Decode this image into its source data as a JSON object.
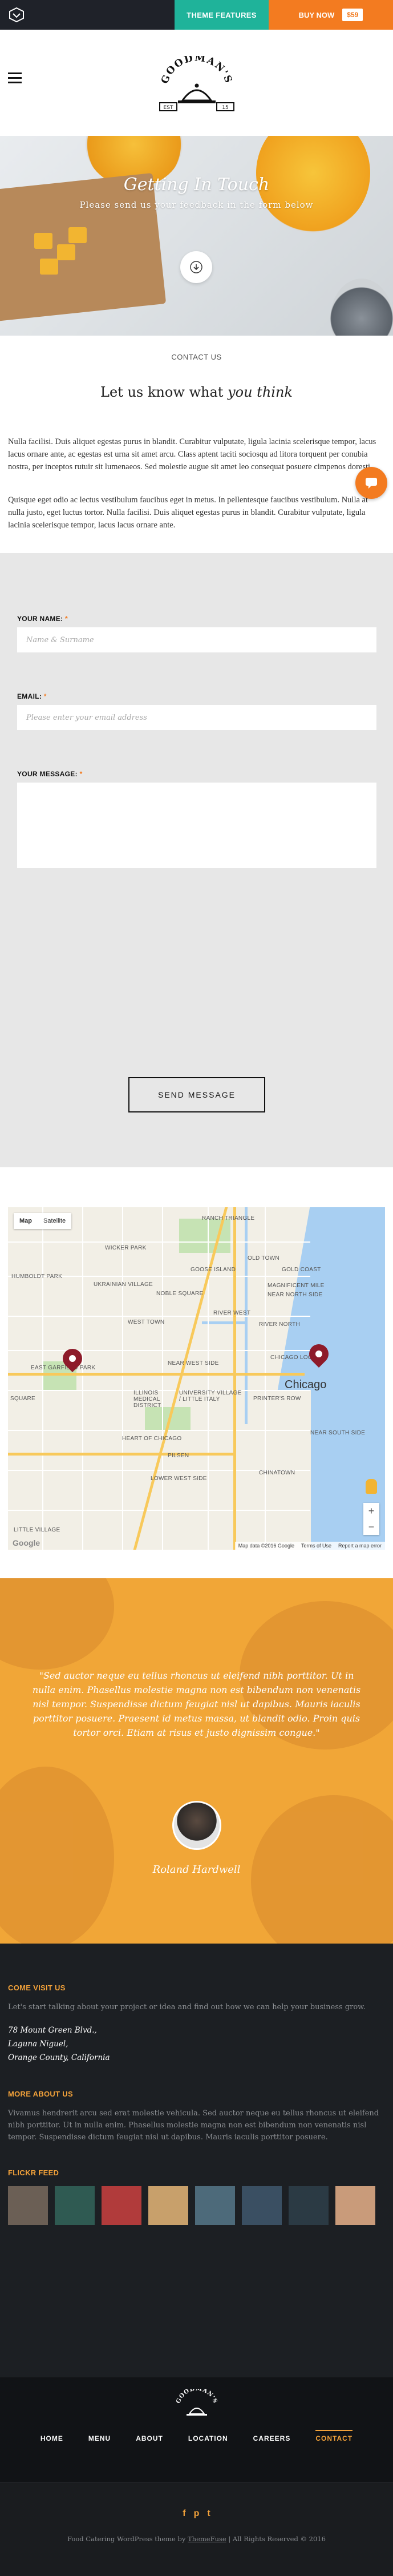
{
  "topbar": {
    "theme_features": "THEME FEATURES",
    "buy_now": "BUY NOW",
    "price": "$59"
  },
  "brand": {
    "name": "GOODMAN'S",
    "year_left": "EST",
    "year_right": "15"
  },
  "hero": {
    "title": "Getting In Touch",
    "subtitle": "Please send us your feedback in the form below"
  },
  "breadcrumb": "CONTACT US",
  "section": {
    "title_plain": "Let us know what ",
    "title_em": "you think"
  },
  "paragraphs": [
    "Nulla facilisi. Duis aliquet egestas purus in blandit. Curabitur vulputate, ligula lacinia scelerisque tempor, lacus lacus ornare ante, ac egestas est urna sit amet arcu. Class aptent taciti sociosqu ad litora torquent per conubia nostra, per inceptos rutuir sit lumenaeos. Sed molestie augue sit amet leo consequat posuere cimpenos doresti.",
    "Quisque eget odio ac lectus vestibulum faucibus eget in metus. In pellentesque faucibus vestibulum. Nulla at nulla justo, eget luctus tortor. Nulla facilisi. Duis aliquet egestas purus in blandit. Curabitur vulputate, ligula lacinia scelerisque tempor, lacus lacus ornare ante."
  ],
  "form": {
    "name_label": "YOUR NAME:",
    "name_placeholder": "Name & Surname",
    "email_label": "EMAIL:",
    "email_placeholder": "Please enter your email address",
    "message_label": "YOUR MESSAGE:",
    "required_mark": "*",
    "send_label": "SEND MESSAGE"
  },
  "map": {
    "map_btn": "Map",
    "satellite_btn": "Satellite",
    "city": "Chicago",
    "labels": [
      "RANCH TRIANGLE",
      "WICKER PARK",
      "GOOSE ISLAND",
      "OLD TOWN",
      "GOLD COAST",
      "HUMBOLDT PARK",
      "UKRAINIAN VILLAGE",
      "NOBLE SQUARE",
      "MAGNIFICENT MILE",
      "NEAR NORTH SIDE",
      "WEST TOWN",
      "RIVER WEST",
      "RIVER NORTH",
      "EAST GARFIELD PARK",
      "NEAR WEST SIDE",
      "CHICAGO LOOP",
      "ILLINOIS MEDICAL DISTRICT",
      "UNIVERSITY VILLAGE / LITTLE ITALY",
      "SQUARE",
      "PRINTER'S ROW",
      "NEAR SOUTH SIDE",
      "HEART OF CHICAGO",
      "PILSEN",
      "LOWER WEST SIDE",
      "CHINATOWN",
      "LITTLE VILLAGE"
    ],
    "footer_data": "Map data ©2016 Google",
    "footer_terms": "Terms of Use",
    "footer_report": "Report a map error",
    "google": "Google"
  },
  "testimonial": {
    "quote": "\"Sed auctor neque eu tellus rhoncus ut eleifend nibh porttitor. Ut in nulla enim. Phasellus molestie magna non est bibendum non venenatis nisl tempor. Suspendisse dictum feugiat nisl ut dapibus. Mauris iaculis porttitor posuere. Praesent id metus massa, ut blandit odio. Proin quis tortor orci. Etiam at risus et justo dignissim congue.\"",
    "name": "Roland Hardwell"
  },
  "footer": {
    "visit_title": "COME VISIT US",
    "visit_text": "Let's start talking about your project or idea and find out how we can help your business grow.",
    "address": [
      "78 Mount Green Blvd.,",
      "Laguna Niguel,",
      "Orange County, California"
    ],
    "about_title": "MORE ABOUT US",
    "about_text": "Vivamus hendrerit arcu sed erat molestie vehicula. Sed auctor neque eu tellus rhoncus ut eleifend nibh porttitor. Ut in nulla enim. Phasellus molestie magna non est bibendum non venenatis nisl tempor. Suspendisse dictum feugiat nisl ut dapibus. Mauris iaculis porttitor posuere.",
    "flickr_title": "FLICKR FEED",
    "flickr_colors": [
      "#6b5f55",
      "#2f5a52",
      "#b13b3b",
      "#c8a06b",
      "#4d6a7a",
      "#3a4f62",
      "#2b3a44",
      "#c99b7a"
    ],
    "nav": [
      "HOME",
      "MENU",
      "ABOUT",
      "LOCATION",
      "CAREERS",
      "CONTACT"
    ],
    "social": [
      "f",
      "p",
      "t"
    ],
    "copyright_prefix": "Food Catering WordPress theme by ",
    "copyright_link": "ThemeFuse",
    "copyright_suffix": " | All Rights Reserved © 2016"
  },
  "colors": {
    "accent": "#f37b20",
    "teal": "#1fb39a",
    "gold": "#f3a23a",
    "dark": "#1c1f23"
  }
}
